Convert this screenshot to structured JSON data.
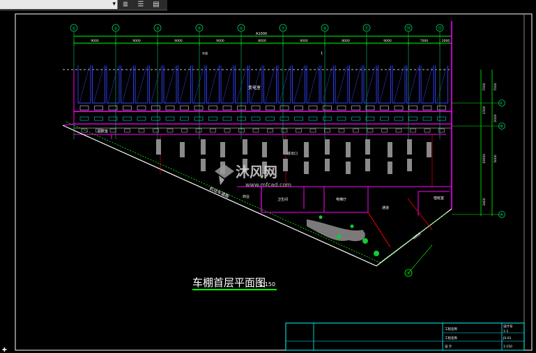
{
  "toolbar": {
    "icons": [
      "layer-icon",
      "layers-stack-icon",
      "layer-properties-icon"
    ]
  },
  "drawing": {
    "title": "车棚首层平面图",
    "scale": "1:150",
    "axis_labels": [
      "①",
      "②",
      "③",
      "④",
      "⑤",
      "⑦",
      "⑨",
      "⑪",
      "⑭",
      "⑮"
    ],
    "right_axis_labels": [
      "C",
      "B",
      "A"
    ],
    "bottom_axis_label": "⑭",
    "total_dim": "A1000",
    "bay_dims": [
      "9000",
      "9000",
      "9000",
      "9000",
      "8000",
      "9000",
      "8000",
      "9000",
      "7000",
      "2000"
    ],
    "right_dims": [
      "7000",
      "7000",
      "1500",
      "2000",
      "10000",
      "5000",
      "3400"
    ],
    "rooms": [
      "变电室",
      "收费室",
      "值班室",
      "商业",
      "卫生间",
      "电梯厅",
      "通道",
      "进出口",
      "值班室"
    ],
    "road_label": "机动车道路",
    "small_label_1": "车道",
    "bottom_dim": "6000",
    "number_1": "1"
  },
  "watermark": {
    "brand": "沐风网",
    "url": "www.mfcad.com"
  },
  "titleblock": {
    "cells": [
      "工程名称",
      "设计号",
      "图号",
      "日期",
      "工程名称",
      "设 计",
      "校 对",
      "比例",
      "图别"
    ],
    "codes": [
      "1-1",
      "JS-01",
      "1:150"
    ]
  },
  "colors": {
    "axis": "#00cc66",
    "wall": "#ff00ff",
    "frame": "#00ffff",
    "parking": "#3344ff",
    "dim": "#00ff00"
  }
}
